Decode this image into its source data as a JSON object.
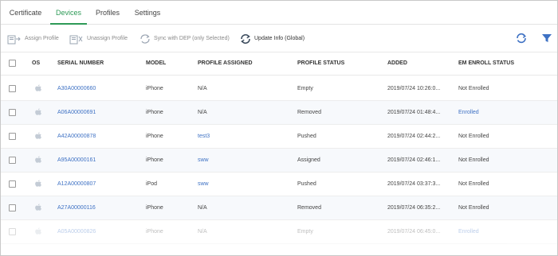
{
  "tabs": [
    "Certificate",
    "Devices",
    "Profiles",
    "Settings"
  ],
  "active_tab": "Devices",
  "toolbar": {
    "assign_profile": "Assign Profile",
    "unassign_profile": "Unassign Profile",
    "sync_dep": "Sync with DEP (only Selected)",
    "update_info": "Update Info (Global)"
  },
  "table": {
    "columns": [
      "OS",
      "SERIAL NUMBER",
      "MODEL",
      "PROFILE ASSIGNED",
      "PROFILE STATUS",
      "ADDED",
      "EM ENROLL STATUS"
    ],
    "rows": [
      {
        "serial": "A30A00000660",
        "model": "iPhone",
        "profile": "N/A",
        "status": "Empty",
        "added": "2019/07/24 10:26:0...",
        "enroll": "Not Enrolled"
      },
      {
        "serial": "A06A00000691",
        "model": "iPhone",
        "profile": "N/A",
        "status": "Removed",
        "added": "2019/07/24 01:48:4...",
        "enroll": "Enrolled"
      },
      {
        "serial": "A42A00000878",
        "model": "iPhone",
        "profile": "test3",
        "status": "Pushed",
        "added": "2019/07/24 02:44:2...",
        "enroll": "Not Enrolled"
      },
      {
        "serial": "A95A00000161",
        "model": "iPhone",
        "profile": "sww",
        "status": "Assigned",
        "added": "2019/07/24 02:46:1...",
        "enroll": "Not Enrolled"
      },
      {
        "serial": "A12A00000807",
        "model": "iPod",
        "profile": "sww",
        "status": "Pushed",
        "added": "2019/07/24 03:37:3...",
        "enroll": "Not Enrolled"
      },
      {
        "serial": "A27A00000116",
        "model": "iPhone",
        "profile": "N/A",
        "status": "Removed",
        "added": "2019/07/24 06:35:2...",
        "enroll": "Not Enrolled"
      },
      {
        "serial": "A05A00000826",
        "model": "iPhone",
        "profile": "N/A",
        "status": "Empty",
        "added": "2019/07/24 06:45:0...",
        "enroll": "Enrolled"
      }
    ]
  },
  "icons": {
    "os": "apple-icon",
    "refresh": "refresh-icon",
    "filter": "filter-icon"
  },
  "colors": {
    "accent": "#2e9a57",
    "link": "#3f72c4",
    "filter": "#3f72c4"
  }
}
